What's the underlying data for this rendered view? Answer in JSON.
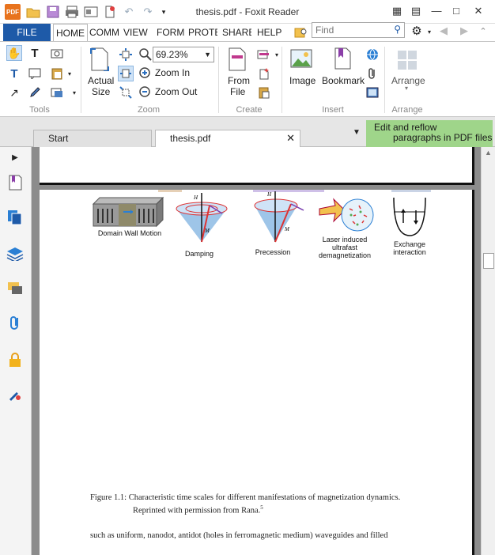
{
  "window": {
    "title": "thesis.pdf - Foxit Reader"
  },
  "ribbon_tabs": {
    "file": "FILE",
    "home": "HOME",
    "comment": "COMM",
    "view": "VIEW",
    "form": "FORM",
    "protect": "PROTE",
    "share": "SHARE",
    "help": "HELP"
  },
  "search": {
    "placeholder": "Find"
  },
  "ribbon": {
    "zoom_value": "69.23%",
    "actual_size_1": "Actual",
    "actual_size_2": "Size",
    "zoom_in": "Zoom In",
    "zoom_out": "Zoom Out",
    "from_file_1": "From",
    "from_file_2": "File",
    "image": "Image",
    "bookmark": "Bookmark",
    "arrange": "Arrange",
    "groups": {
      "tools": "Tools",
      "zoom": "Zoom",
      "create": "Create",
      "insert": "Insert",
      "arrange": "Arrange"
    }
  },
  "doc_tabs": {
    "start": "Start",
    "current": "thesis.pdf"
  },
  "reflow_tip": {
    "line1": "Edit and reflow",
    "line2": "paragraphs in PDF files"
  },
  "figure": {
    "labels": {
      "domain_wall": "Domain Wall Motion",
      "damping": "Damping",
      "precession": "Precession",
      "laser_1": "Laser induced",
      "laser_2": "ultrafast",
      "laser_3": "demagnetization",
      "exchange_1": "Exchange",
      "exchange_2": "interaction"
    },
    "caption_1": "Figure 1.1: Characteristic time scales for different manifestations of magnetization dynamics.",
    "caption_2": "Reprinted with permission from Rana.",
    "caption_ref": "5",
    "body_text": "such as uniform, nanodot, antidot (holes in ferromagnetic medium) waveguides and filled"
  },
  "colors": {
    "file_tab": "#1e5aa8",
    "reflow_bg": "#9fd58a",
    "viewer_bg": "#8c8c8c"
  }
}
